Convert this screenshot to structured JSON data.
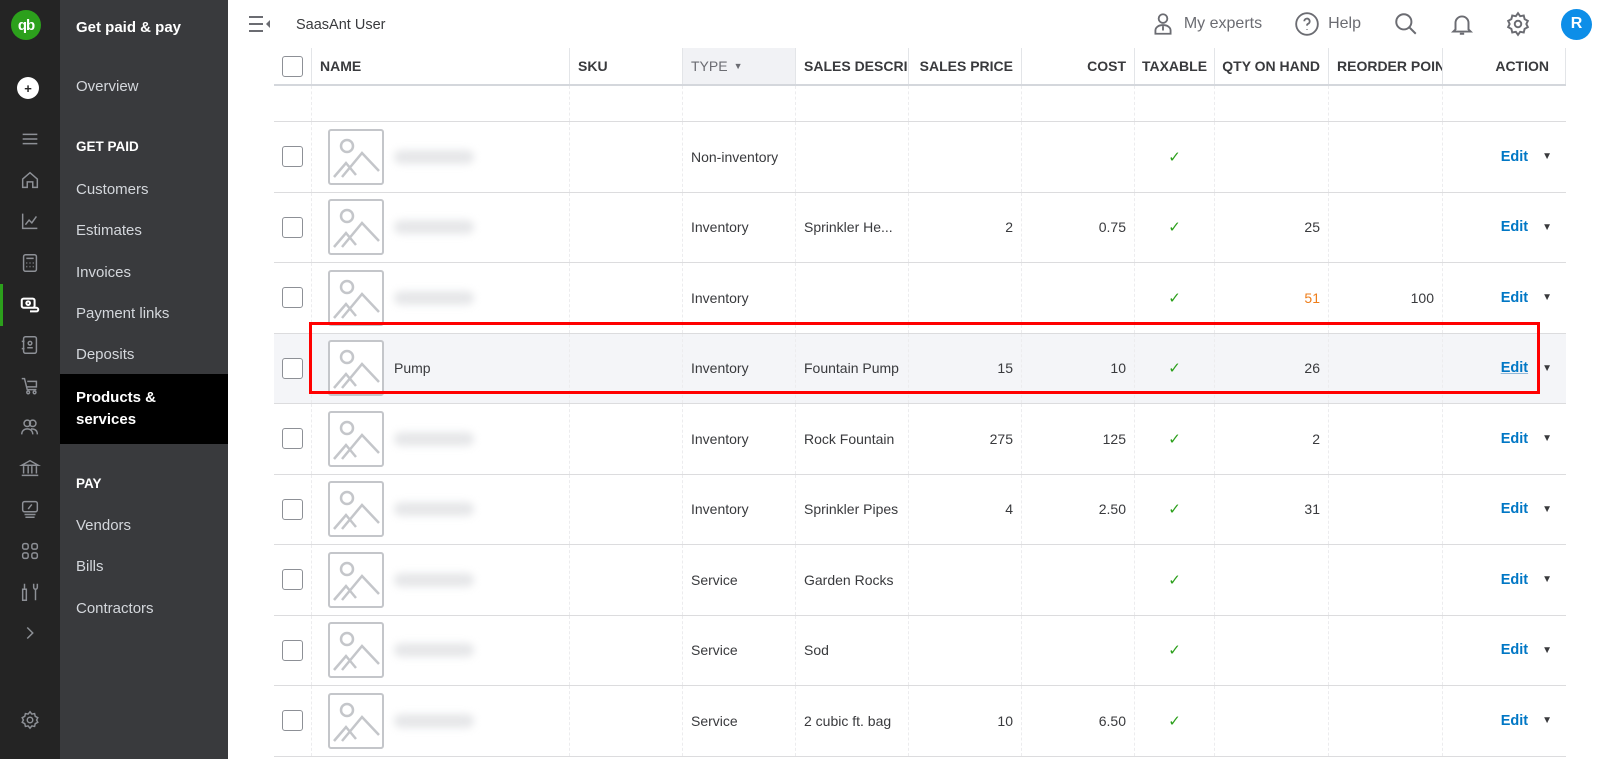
{
  "app": {
    "logo_text": "qb",
    "company_name": "SaasAnt User",
    "accent_color": "#2ca01c",
    "highlight_color": "#ff0000"
  },
  "rail": {
    "icons": [
      "menu-icon",
      "home-icon",
      "chart-icon",
      "calculator-icon",
      "payments-icon",
      "contacts-book-icon",
      "cart-icon",
      "people-icon",
      "bank-icon",
      "tax-icon",
      "apps-icon",
      "tools-icon",
      "chevron-right-icon",
      "gear-icon"
    ],
    "active": "payments-icon"
  },
  "subnav": {
    "title": "Get paid & pay",
    "overview": "Overview",
    "section_get_paid": "GET PAID",
    "get_paid_items": [
      "Customers",
      "Estimates",
      "Invoices",
      "Payment links",
      "Deposits",
      "Products & services"
    ],
    "section_pay": "PAY",
    "pay_items": [
      "Vendors",
      "Bills",
      "Contractors"
    ],
    "active_item": "Products & services"
  },
  "topbar": {
    "my_experts": "My experts",
    "help": "Help",
    "avatar_initial": "R"
  },
  "table": {
    "columns": {
      "name": "NAME",
      "sku": "SKU",
      "type": "TYPE",
      "desc": "SALES DESCRIPT",
      "price": "SALES PRICE",
      "cost": "COST",
      "taxable": "TAXABLE",
      "qty": "QTY ON HAND",
      "reorder": "REORDER POINT",
      "action": "ACTION"
    },
    "sort_column": "TYPE",
    "sort_direction": "desc",
    "edit_label": "Edit",
    "check_glyph": "✓",
    "rows": [
      {
        "name": "",
        "name_blurred": true,
        "type": "Non-inventory",
        "desc": "",
        "price": "",
        "cost": "",
        "taxable": true,
        "qty": "",
        "qty_low": false,
        "reorder": ""
      },
      {
        "name": "",
        "name_blurred": true,
        "type": "Inventory",
        "desc": "Sprinkler He...",
        "price": "2",
        "cost": "0.75",
        "taxable": true,
        "qty": "25",
        "qty_low": false,
        "reorder": ""
      },
      {
        "name": "",
        "name_blurred": true,
        "type": "Inventory",
        "desc": "",
        "price": "",
        "cost": "",
        "taxable": true,
        "qty": "51",
        "qty_low": true,
        "reorder": "100"
      },
      {
        "name": "Pump",
        "name_blurred": false,
        "type": "Inventory",
        "desc": "Fountain Pump",
        "price": "15",
        "cost": "10",
        "taxable": true,
        "qty": "26",
        "qty_low": false,
        "reorder": "",
        "highlighted": true
      },
      {
        "name": "",
        "name_blurred": true,
        "type": "Inventory",
        "desc": "Rock Fountain",
        "price": "275",
        "cost": "125",
        "taxable": true,
        "qty": "2",
        "qty_low": false,
        "reorder": ""
      },
      {
        "name": "",
        "name_blurred": true,
        "type": "Inventory",
        "desc": "Sprinkler Pipes",
        "price": "4",
        "cost": "2.50",
        "taxable": true,
        "qty": "31",
        "qty_low": false,
        "reorder": ""
      },
      {
        "name": "",
        "name_blurred": true,
        "type": "Service",
        "desc": "Garden Rocks",
        "price": "",
        "cost": "",
        "taxable": true,
        "qty": "",
        "qty_low": false,
        "reorder": ""
      },
      {
        "name": "",
        "name_blurred": true,
        "type": "Service",
        "desc": "Sod",
        "price": "",
        "cost": "",
        "taxable": true,
        "qty": "",
        "qty_low": false,
        "reorder": ""
      },
      {
        "name": "",
        "name_blurred": true,
        "type": "Service",
        "desc": "2 cubic ft. bag",
        "price": "10",
        "cost": "6.50",
        "taxable": true,
        "qty": "",
        "qty_low": false,
        "reorder": ""
      }
    ]
  }
}
